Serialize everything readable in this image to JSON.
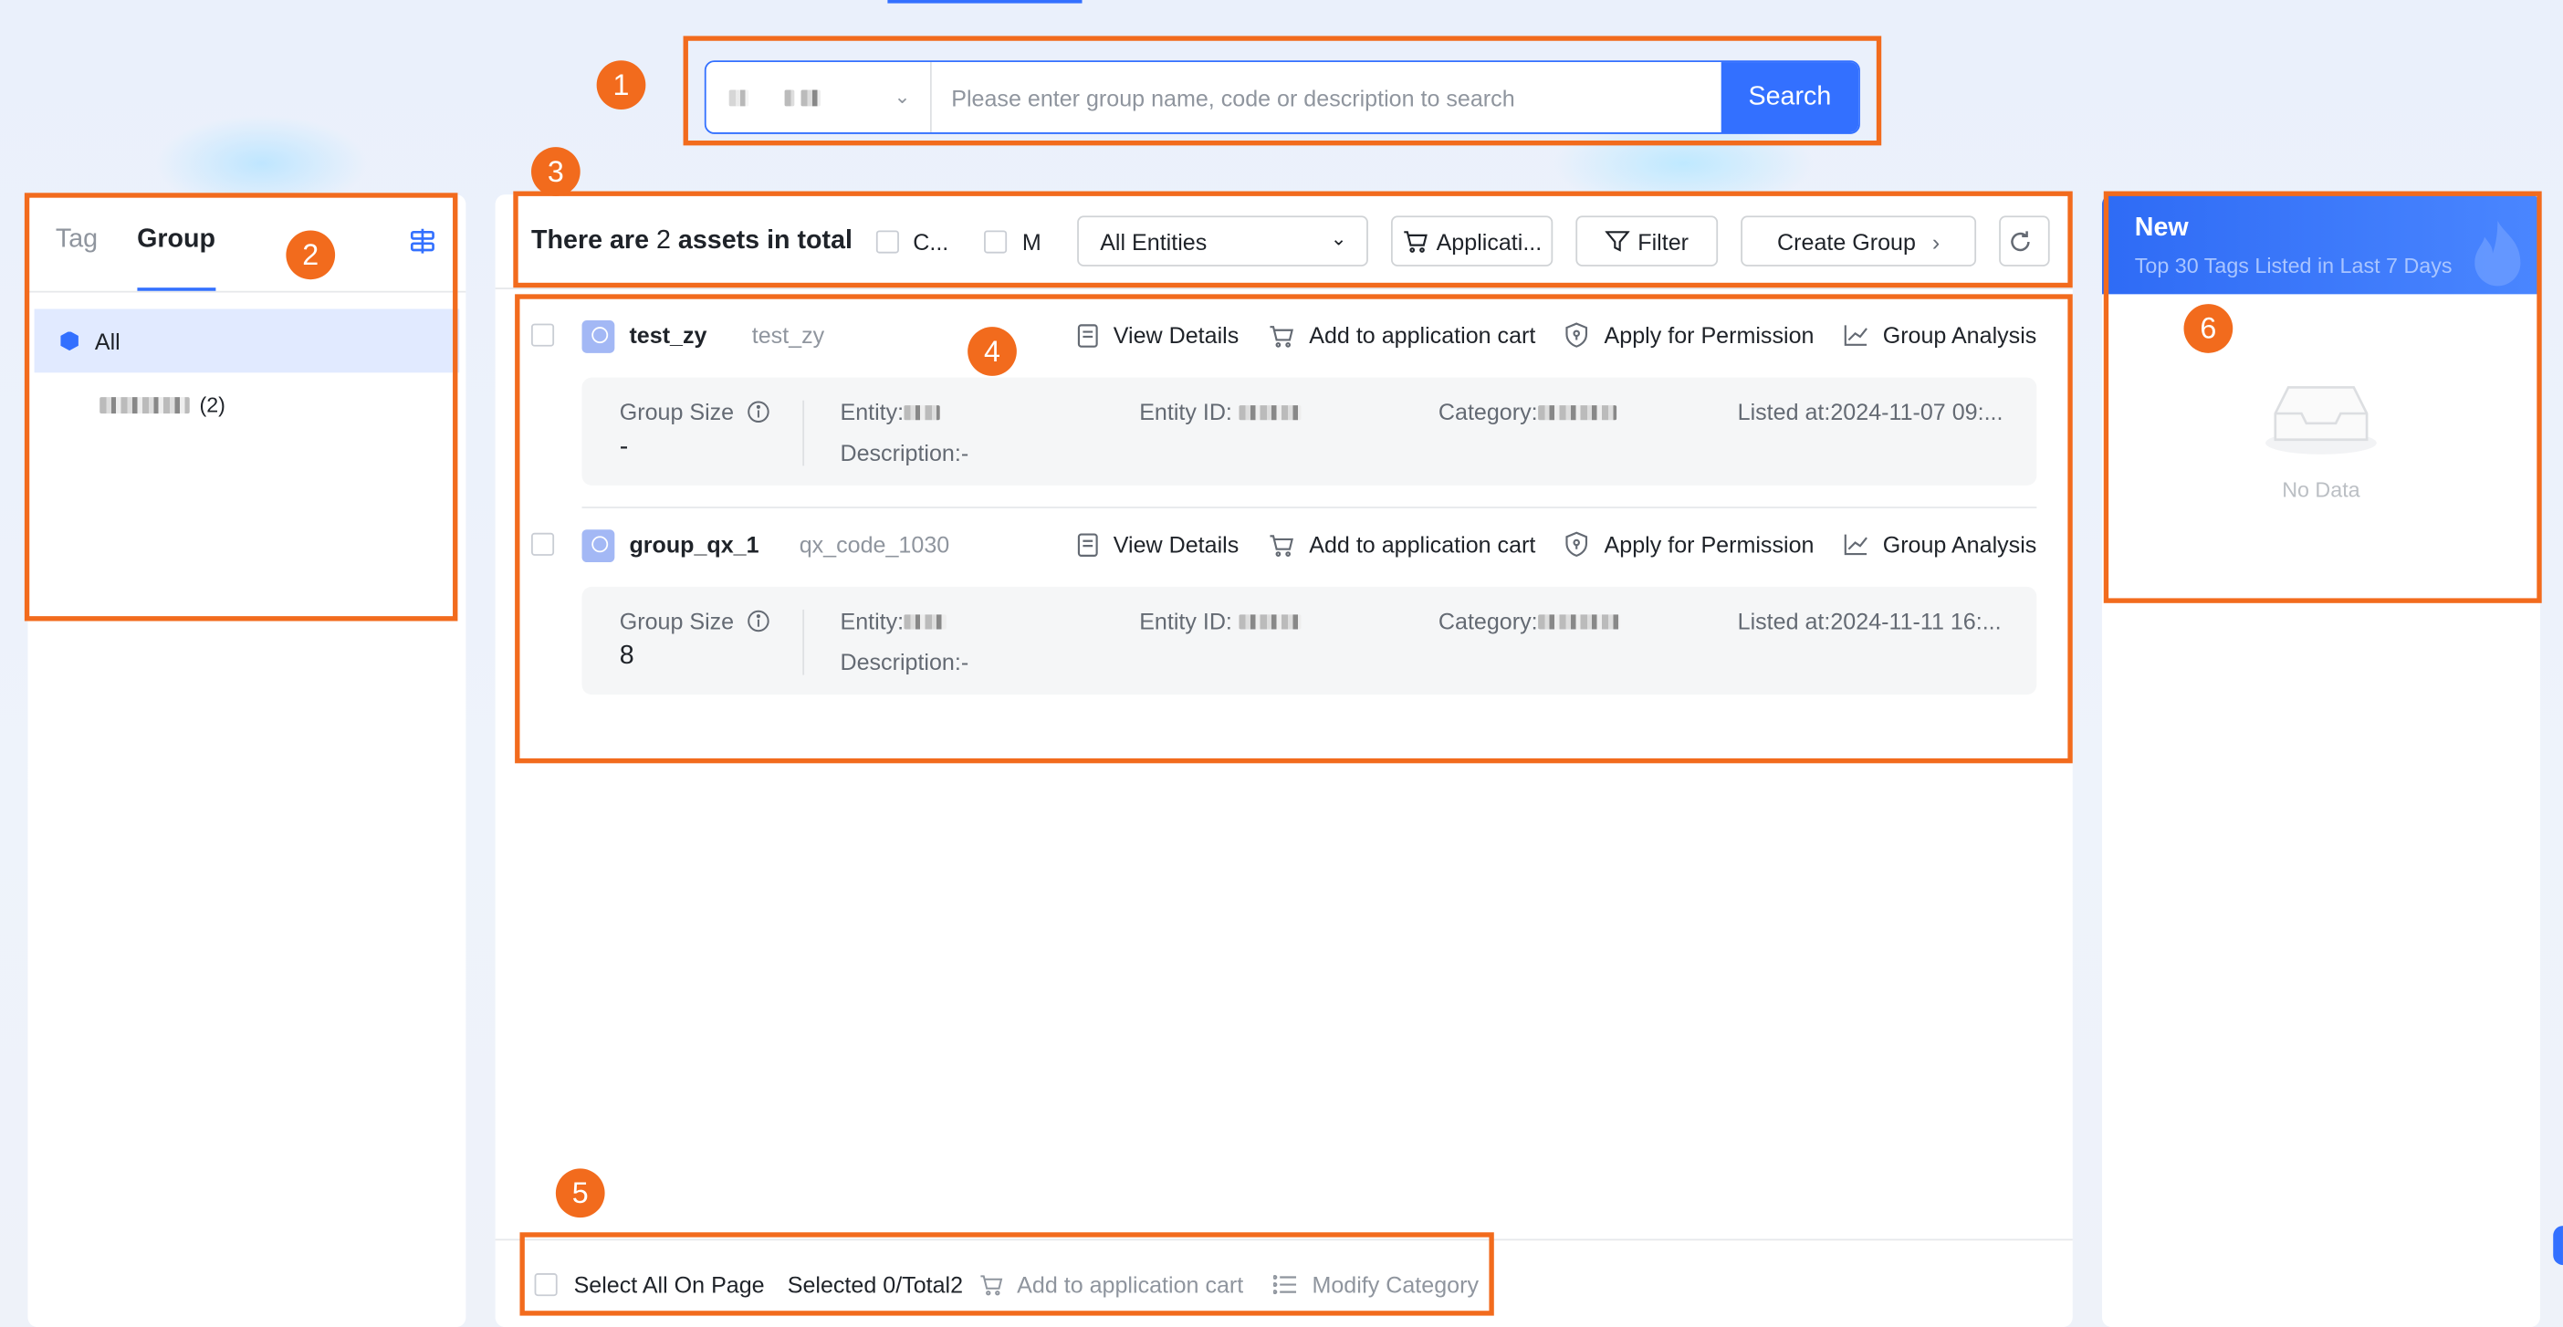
{
  "search": {
    "placeholder": "Please enter group name, code or description to search",
    "button_label": "Search"
  },
  "left_panel": {
    "tabs": [
      {
        "label": "Tag",
        "active": false
      },
      {
        "label": "Group",
        "active": true
      }
    ],
    "all_label": "All",
    "sub_count": "(2)"
  },
  "toolbar": {
    "total_prefix": "There are ",
    "total_count": "2",
    "total_suffix": " assets in total",
    "check1_label": "C...",
    "check2_label": "M",
    "entity_select": "All Entities",
    "cart_button": "Applicati...",
    "filter_button": "Filter",
    "create_button": "Create Group"
  },
  "actions": {
    "view": "View Details",
    "cart": "Add to application cart",
    "apply": "Apply for Permission",
    "analysis": "Group Analysis"
  },
  "labels": {
    "group_size": "Group Size",
    "entity": "Entity:",
    "entity_id": "Entity ID:",
    "category": "Category:",
    "description": "Description:-"
  },
  "groups": [
    {
      "name": "test_zy",
      "code": "test_zy",
      "group_size": "-",
      "listed_at": "Listed at:2024-11-07 09:..."
    },
    {
      "name": "group_qx_1",
      "code": "qx_code_1030",
      "group_size": "8",
      "listed_at": "Listed at:2024-11-11 16:..."
    }
  ],
  "footer": {
    "select_all": "Select All On Page",
    "selected": "Selected 0/Total2",
    "add_cart": "Add to application cart",
    "modify": "Modify Category"
  },
  "right_panel": {
    "title": "New",
    "subtitle": "Top 30 Tags Listed in Last 7 Days",
    "empty": "No Data"
  },
  "annotations": [
    "1",
    "2",
    "3",
    "4",
    "5",
    "6"
  ],
  "colors": {
    "primary": "#3370ff",
    "annotation": "#f26b1d"
  }
}
